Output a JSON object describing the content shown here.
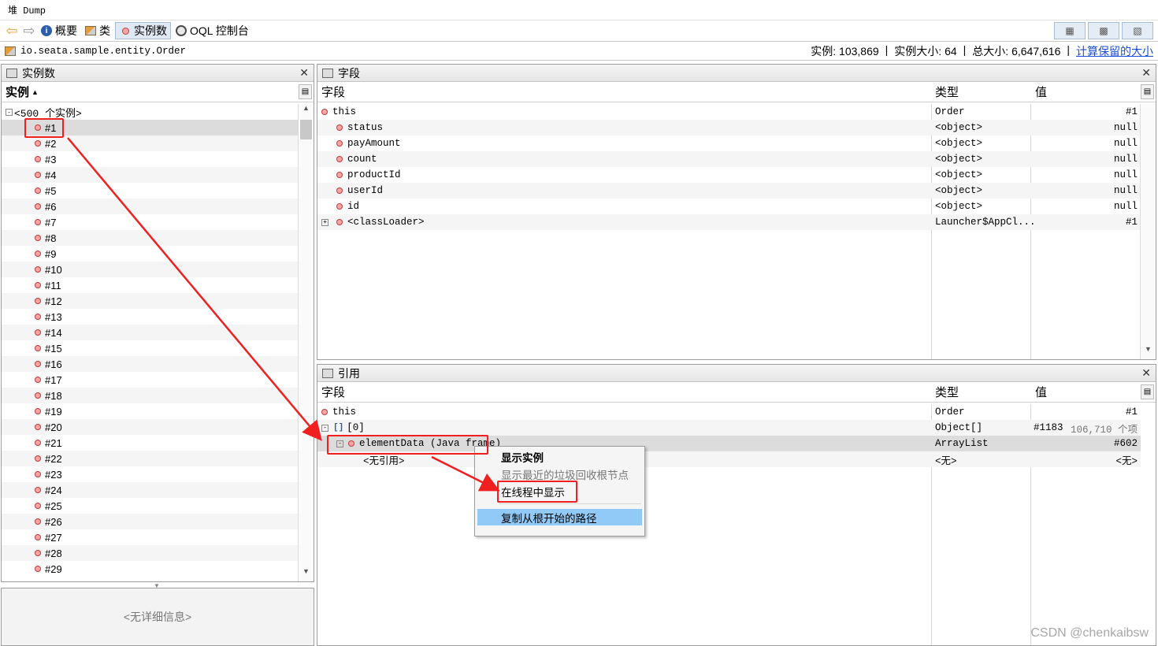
{
  "window": {
    "title": "堆 Dump"
  },
  "toolbar": {
    "summary": "概要",
    "classes": "类",
    "instances": "实例数",
    "oql": "OQL 控制台"
  },
  "classline": {
    "class_name": "io.seata.sample.entity.Order",
    "stats": [
      "实例: 103,869",
      "实例大小: 64",
      "总大小: 6,647,616"
    ],
    "compute_link": "计算保留的大小"
  },
  "instances_panel": {
    "title": "实例数",
    "col_header": "实例",
    "group_label": "<500 个实例>",
    "items": [
      "#1",
      "#2",
      "#3",
      "#4",
      "#5",
      "#6",
      "#7",
      "#8",
      "#9",
      "#10",
      "#11",
      "#12",
      "#13",
      "#14",
      "#15",
      "#16",
      "#17",
      "#18",
      "#19",
      "#20",
      "#21",
      "#22",
      "#23",
      "#24",
      "#25",
      "#26",
      "#27",
      "#28",
      "#29"
    ],
    "details_empty": "<无详细信息>"
  },
  "fields_panel": {
    "title": "字段",
    "columns": {
      "field": "字段",
      "type": "类型",
      "value": "值"
    },
    "rows": [
      {
        "name": "this",
        "type": "Order",
        "value": "#1"
      },
      {
        "name": "status",
        "type": "<object>",
        "value": "null"
      },
      {
        "name": "payAmount",
        "type": "<object>",
        "value": "null"
      },
      {
        "name": "count",
        "type": "<object>",
        "value": "null"
      },
      {
        "name": "productId",
        "type": "<object>",
        "value": "null"
      },
      {
        "name": "userId",
        "type": "<object>",
        "value": "null"
      },
      {
        "name": "id",
        "type": "<object>",
        "value": "null"
      },
      {
        "name": "<classLoader>",
        "type": "Launcher$AppCl...",
        "value": "#1"
      }
    ]
  },
  "refs_panel": {
    "title": "引用",
    "columns": {
      "field": "字段",
      "type": "类型",
      "value": "值"
    },
    "rows": [
      {
        "name": "this",
        "type": "Order",
        "value": "#1",
        "extra": ""
      },
      {
        "name": "[0]",
        "type": "Object[]",
        "value": "#1183",
        "extra": "106,710 个项"
      },
      {
        "name": "elementData (Java frame)",
        "type": "ArrayList",
        "value": "#602",
        "extra": ""
      },
      {
        "name": "<无引用>",
        "type": "<无>",
        "value": "<无>",
        "extra": ""
      }
    ]
  },
  "context_menu": {
    "items": [
      "显示实例",
      "显示最近的垃圾回收根节点",
      "在线程中显示",
      "复制从根开始的路径"
    ]
  },
  "watermark": "CSDN @chenkaibsw"
}
